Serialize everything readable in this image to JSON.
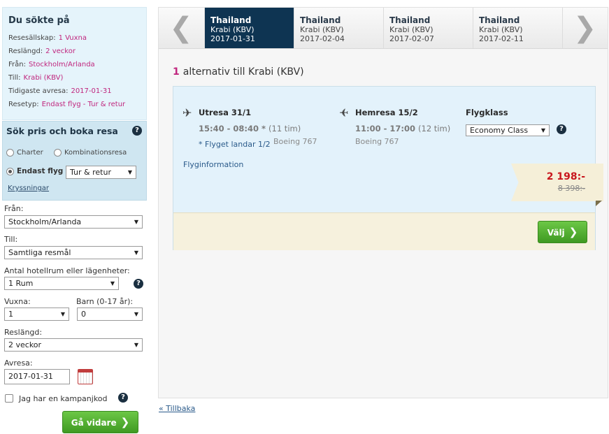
{
  "summary": {
    "title": "Du sökte på",
    "rows": [
      {
        "label": "Resesällskap:",
        "value": "1 Vuxna"
      },
      {
        "label": "Reslängd:",
        "value": "2 veckor"
      },
      {
        "label": "Från:",
        "value": "Stockholm/Arlanda"
      },
      {
        "label": "Till:",
        "value": "Krabi (KBV)"
      },
      {
        "label": "Tidigaste avresa:",
        "value": "2017-01-31"
      },
      {
        "label": "Resetyp:",
        "value": "Endast flyg - Tur & retur"
      }
    ]
  },
  "booking": {
    "title": "Sök pris och boka resa",
    "help": "?",
    "options": [
      "Charter",
      "Kombinationsresa",
      "Endast flyg"
    ],
    "selected_option": "Endast flyg",
    "trip_type": "Tur & retur",
    "cruise_link": "Kryssningar"
  },
  "search": {
    "from_label": "Från:",
    "from_value": "Stockholm/Arlanda",
    "to_label": "Till:",
    "to_value": "Samtliga resmål",
    "rooms_label": "Antal hotellrum eller lägenheter:",
    "rooms_value": "1 Rum",
    "adults_label": "Vuxna:",
    "adults_value": "1",
    "children_label": "Barn (0-17 år):",
    "children_value": "0",
    "length_label": "Reslängd:",
    "length_value": "2 veckor",
    "depart_label": "Avresa:",
    "depart_value": "2017-01-31",
    "campaign_label": "Jag har en kampanjkod",
    "submit": "Gå vidare"
  },
  "tabs": [
    {
      "country": "Thailand",
      "dest": "Krabi (KBV)",
      "date": "2017-01-31",
      "active": true
    },
    {
      "country": "Thailand",
      "dest": "Krabi (KBV)",
      "date": "2017-02-04",
      "active": false
    },
    {
      "country": "Thailand",
      "dest": "Krabi (KBV)",
      "date": "2017-02-07",
      "active": false
    },
    {
      "country": "Thailand",
      "dest": "Krabi (KBV)",
      "date": "2017-02-11",
      "active": false
    }
  ],
  "results": {
    "count": "1",
    "text": "alternativ till Krabi (KBV)"
  },
  "flight": {
    "out_title": "Utresa 31/1",
    "out_times": "15:40 - 08:40 *",
    "out_duration": "(11 tim)",
    "out_note": "* Flyget landar 1/2",
    "out_aircraft": "Boeing 767",
    "ret_title": "Hemresa 15/2",
    "ret_times": "11:00 - 17:00",
    "ret_duration": "(12 tim)",
    "ret_aircraft": "Boeing 767",
    "class_label": "Flygklass",
    "class_value": "Economy Class",
    "info_link": "Flyginformation",
    "price": "2 198:-",
    "old_price": "8 398:-",
    "select_button": "Välj"
  },
  "footer": {
    "back": "« Tillbaka"
  },
  "colors": {
    "accent": "#c0267e",
    "nav_active": "#0e3452",
    "button_green": "#4aa82a",
    "price_red": "#c8161d"
  }
}
